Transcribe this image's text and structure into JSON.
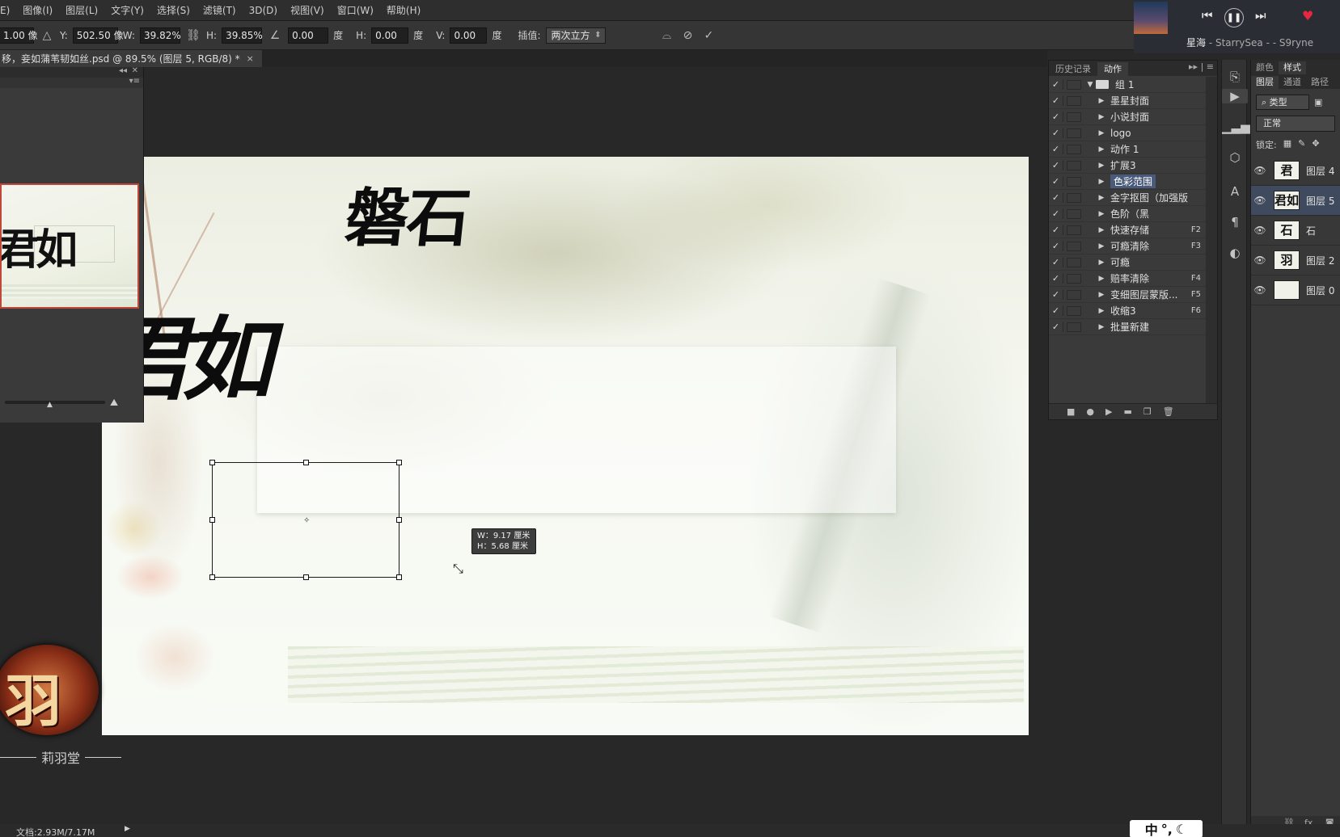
{
  "menu": {
    "items": [
      "E)",
      "图像(I)",
      "图层(L)",
      "文字(Y)",
      "选择(S)",
      "滤镜(T)",
      "3D(D)",
      "视图(V)",
      "窗口(W)",
      "帮助(H)"
    ]
  },
  "options": {
    "w_prefix": "1.00 像",
    "y_label": "Y:",
    "y_value": "502.50 像",
    "w_label": "W:",
    "w_value": "39.82%",
    "h_label": "H:",
    "h_value": "39.85%",
    "angle_value": "0.00",
    "degree": "度",
    "hskew_label": "H:",
    "hskew_value": "0.00",
    "vskew_label": "V:",
    "vskew_value": "0.00",
    "interp_label": "插值:",
    "interp_value": "两次立方"
  },
  "document": {
    "tab_title": "移，妾如蒲苇韧如丝.psd @ 89.5% (图层 5, RGB/8) *",
    "close": "×"
  },
  "canvas": {
    "top_text": "磐石",
    "main_text": "君如",
    "size_tip_w": "W：9.17 厘米",
    "size_tip_h": "H：5.68 厘米"
  },
  "logo": {
    "glyph": "羽",
    "text": "莉羽堂"
  },
  "status": {
    "doc_size": "文档:2.93M/7.17M"
  },
  "ime": {
    "label": "中",
    "extra": "°,"
  },
  "actions_panel": {
    "tab_history": "历史记录",
    "tab_actions": "动作",
    "items": [
      {
        "name": "组 1",
        "key": "",
        "folder": true
      },
      {
        "name": "墨星封面",
        "key": ""
      },
      {
        "name": "小说封面",
        "key": ""
      },
      {
        "name": "logo",
        "key": ""
      },
      {
        "name": "动作 1",
        "key": ""
      },
      {
        "name": "扩展3",
        "key": ""
      },
      {
        "name": "色彩范围",
        "key": "",
        "selected": true
      },
      {
        "name": "金字抠图（加强版",
        "key": ""
      },
      {
        "name": "色阶（黑",
        "key": ""
      },
      {
        "name": "快速存储",
        "key": "F2"
      },
      {
        "name": "可瘾清除",
        "key": "F3"
      },
      {
        "name": "可瘾",
        "key": ""
      },
      {
        "name": "赔率清除",
        "key": "F4"
      },
      {
        "name": "变细图层蒙版...",
        "key": "F5"
      },
      {
        "name": "收缩3",
        "key": "F6"
      },
      {
        "name": "批量新建",
        "key": ""
      }
    ]
  },
  "music": {
    "title": "星海",
    "artist": " - StarrySea - - S9ryne"
  },
  "layers_panel": {
    "tab_color": "颜色",
    "tab_style": "样式",
    "tab_layers": "图层",
    "tab_channels": "通道",
    "tab_paths": "路径",
    "filter": "类型",
    "blend": "正常",
    "lock_label": "锁定:",
    "layers": [
      {
        "name": "图层 4",
        "thumb": "君"
      },
      {
        "name": "图层 5",
        "thumb": "君如",
        "selected": true
      },
      {
        "name": "石",
        "thumb": "石"
      },
      {
        "name": "图层 2",
        "thumb": "羽"
      },
      {
        "name": "图层 0",
        "thumb": ""
      }
    ]
  }
}
